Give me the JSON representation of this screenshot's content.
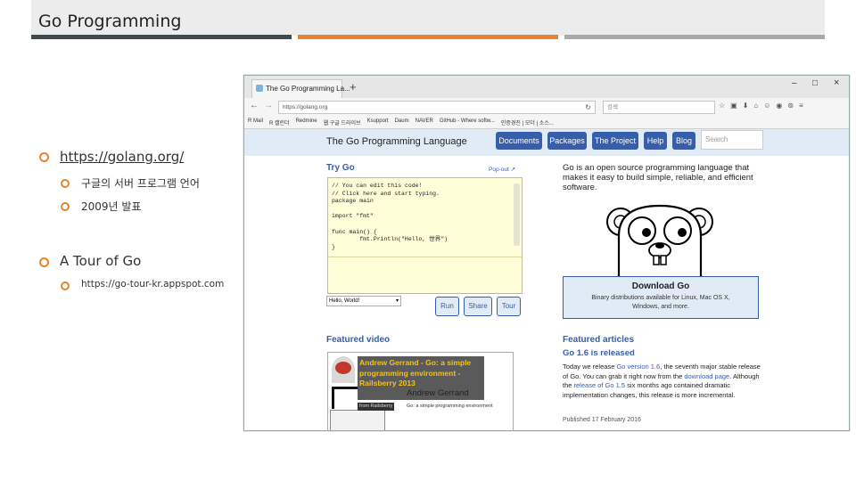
{
  "slide": {
    "title": "Go Programming",
    "bullets": {
      "b1": "https://golang.org/",
      "b1a": "구글의 서버 프로그램 언어",
      "b1b": "2009년 발표",
      "b2": "A Tour of Go",
      "b2a": "https://go-tour-kr.appspot.com"
    }
  },
  "browser": {
    "tab_title": "The Go Programming La...",
    "new_tab": "+",
    "window_controls": [
      "–",
      "□",
      "×"
    ],
    "url": "https://golang.org",
    "search_placeholder": "검색",
    "bookmarks": [
      "R Mail",
      "R 캘린더",
      "Redmine",
      "웹 구글 드라이브",
      "Ksupport",
      "Daum",
      "NAVER",
      "GitHub - Where softw...",
      "인증경진 | 모더 | 소스..."
    ]
  },
  "site": {
    "logo": "The Go Programming Language",
    "nav": [
      "Documents",
      "Packages",
      "The Project",
      "Help",
      "Blog"
    ],
    "search_placeholder": "Search",
    "try_go": "Try Go",
    "popout": "Pop-out",
    "code": "// You can edit this code!\n// Click here and start typing.\npackage main\n\nimport \"fmt\"\n\nfunc main() {\n\tfmt.Println(\"Hello, 世界\")\n}",
    "example_select": "Hello, World!",
    "run": "Run",
    "share": "Share",
    "tour": "Tour",
    "intro": "Go is an open source programming language that makes it easy to build simple, reliable, and efficient software.",
    "download_title": "Download Go",
    "download_sub": "Binary distributions available for Linux, Mac OS X, Windows, and more.",
    "featured_video": "Featured video",
    "video_title": "Andrew Gerrand - Go: a simple programming environment - Railsberry 2013",
    "video_author": "Andrew Gerrand",
    "video_from": "from Railsberry",
    "video_caption": "Go: a simple programming environment",
    "featured_articles": "Featured articles",
    "article_title": "Go 1.6 is released",
    "article_p1": "Today we release ",
    "article_l1": "Go version 1.6",
    "article_p2": ", the seventh major stable release of Go. You can grab it right now from the ",
    "article_l2": "download page",
    "article_p3": ". Although the ",
    "article_l3": "release of Go 1.5",
    "article_p4": " six months ago contained dramatic implementation changes, this release is more incremental.",
    "published": "Published 17 February 2016"
  }
}
